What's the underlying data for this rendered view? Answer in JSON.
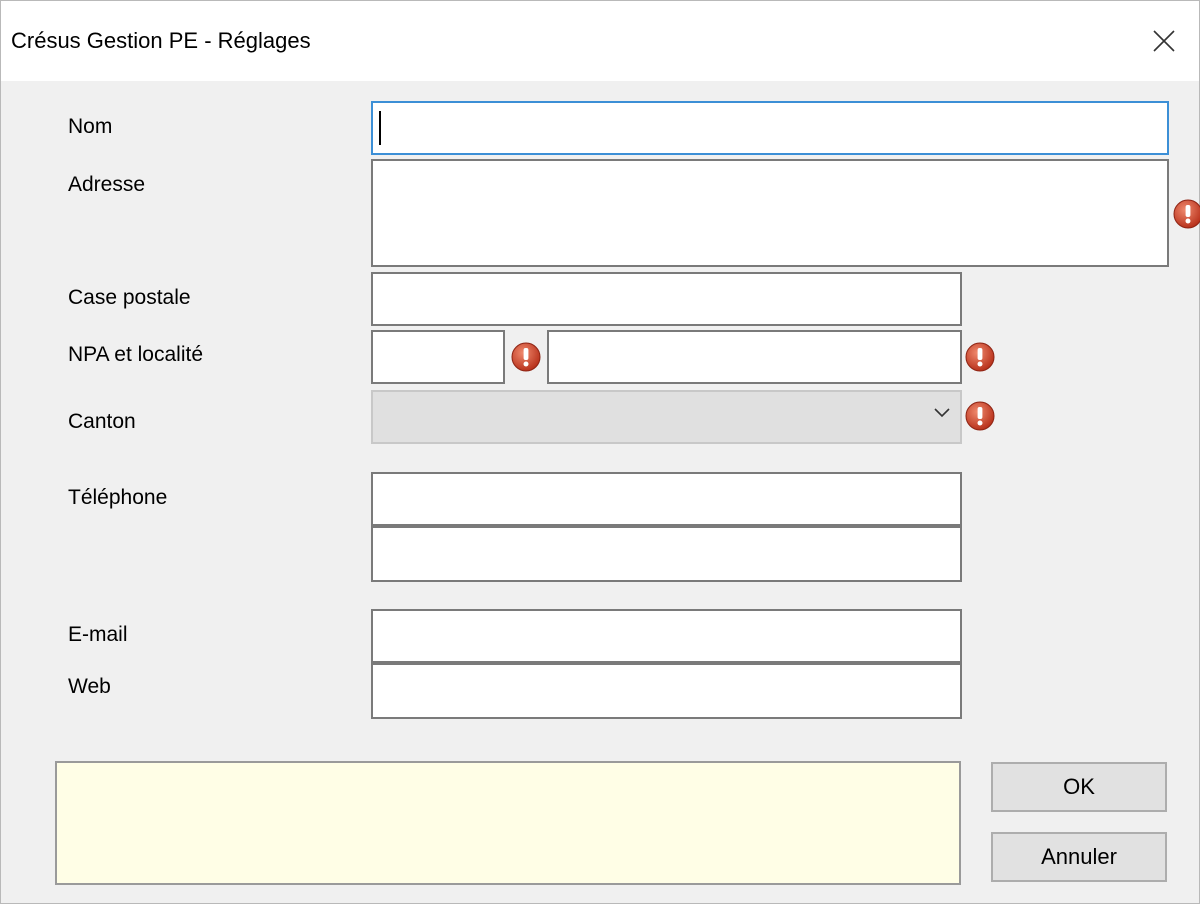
{
  "window": {
    "title": "Crésus Gestion PE - Réglages"
  },
  "labels": {
    "nom": "Nom",
    "adresse": "Adresse",
    "case_postale": "Case postale",
    "npa_localite": "NPA et localité",
    "canton": "Canton",
    "telephone": "Téléphone",
    "email": "E-mail",
    "web": "Web"
  },
  "fields": {
    "nom": "",
    "adresse": "",
    "case_postale": "",
    "npa": "",
    "localite": "",
    "canton": "",
    "telephone_1": "",
    "telephone_2": "",
    "email": "",
    "web": ""
  },
  "message": "",
  "buttons": {
    "ok": "OK",
    "cancel": "Annuler"
  },
  "colors": {
    "focus_border": "#3c8fd6",
    "error_icon": "#d9452b",
    "message_bg": "#fffee6"
  },
  "icons": {
    "close": "close-icon",
    "error": "error-icon",
    "dropdown": "chevron-down-icon"
  }
}
